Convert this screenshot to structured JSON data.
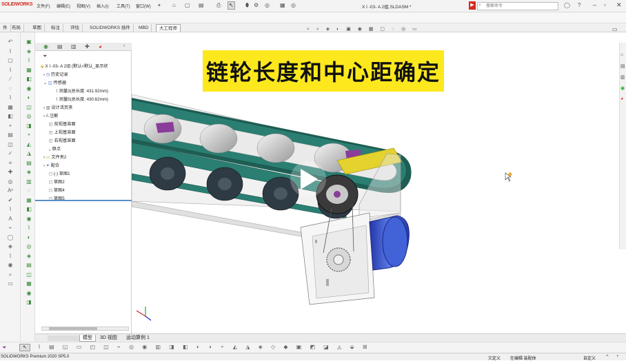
{
  "app": {
    "logo": "SOLIDWORKS",
    "window_title": "X I -03- A 2组.SLDASM *",
    "search_placeholder": "搜索命令",
    "menus": [
      "文件(F)",
      "编辑(E)",
      "视图(V)",
      "插入(I)",
      "工具(T)",
      "窗口(W)"
    ]
  },
  "command_tabs": [
    "件",
    "布局",
    "草图",
    "标注",
    "评估",
    "SOLIDWORKS 插件",
    "MBD",
    "大工程师"
  ],
  "feature_tree": {
    "root": "X I -03- A 2组 (默认<默认_显示状",
    "items": [
      {
        "label": "历史记录",
        "level": 1
      },
      {
        "label": "传感器",
        "level": 1
      },
      {
        "label": "测量3(总长度: 431.92mm)",
        "level": 2
      },
      {
        "label": "测量5(总长度: 430.62mm)",
        "level": 2
      },
      {
        "label": "设计活页夹",
        "level": 1
      },
      {
        "label": "注解",
        "level": 1
      },
      {
        "label": "前视基准面",
        "level": 1
      },
      {
        "label": "上视基准面",
        "level": 1
      },
      {
        "label": "右视基准面",
        "level": 1
      },
      {
        "label": "原点",
        "level": 1
      },
      {
        "label": "文件夹2",
        "level": 1
      },
      {
        "label": "配合",
        "level": 1
      },
      {
        "label": "(-) 草图1",
        "level": 1
      },
      {
        "label": "草图2",
        "level": 1
      },
      {
        "label": "草图4",
        "level": 1
      },
      {
        "label": "草图5",
        "level": 1
      }
    ]
  },
  "banner": {
    "text": "链轮长度和中心距确定"
  },
  "bottom_tabs": [
    "模型",
    "3D 视图",
    "运动算例 1"
  ],
  "status": {
    "left": "SOLIDWORKS Premium 2020 SP5.0",
    "items": [
      "欠定义",
      "在编辑 装配体",
      "自定义"
    ]
  },
  "colors": {
    "belt": "#2a7e72",
    "belt_dark": "#1f5e54",
    "frame": "#e7e7e7",
    "roller_dark": "#2e3a44",
    "plate": "#e4d22e",
    "motor": "#3a55c8",
    "banner": "#fde81e",
    "brand": "#d52b1e"
  }
}
